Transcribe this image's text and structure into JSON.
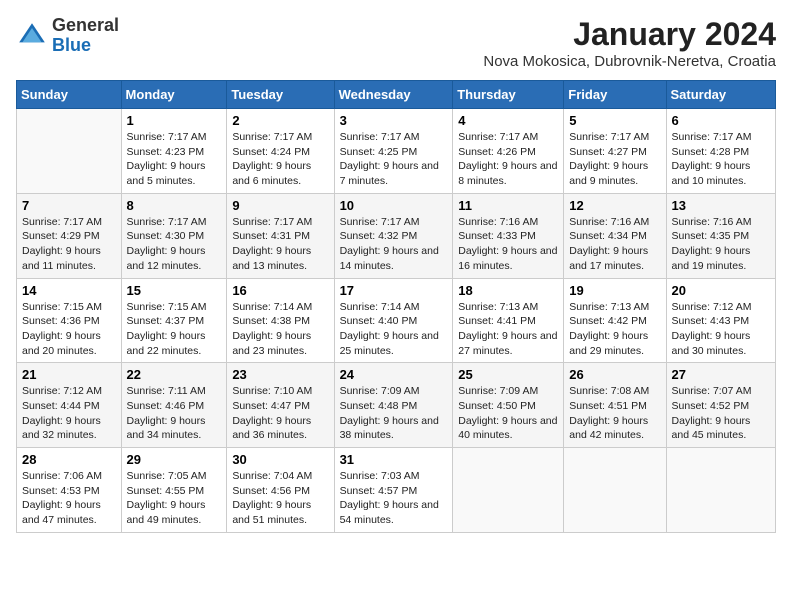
{
  "logo": {
    "general": "General",
    "blue": "Blue"
  },
  "title": "January 2024",
  "subtitle": "Nova Mokosica, Dubrovnik-Neretva, Croatia",
  "days": [
    "Sunday",
    "Monday",
    "Tuesday",
    "Wednesday",
    "Thursday",
    "Friday",
    "Saturday"
  ],
  "weeks": [
    [
      {
        "num": "",
        "sunrise": "",
        "sunset": "",
        "daylight": ""
      },
      {
        "num": "1",
        "sunrise": "Sunrise: 7:17 AM",
        "sunset": "Sunset: 4:23 PM",
        "daylight": "Daylight: 9 hours and 5 minutes."
      },
      {
        "num": "2",
        "sunrise": "Sunrise: 7:17 AM",
        "sunset": "Sunset: 4:24 PM",
        "daylight": "Daylight: 9 hours and 6 minutes."
      },
      {
        "num": "3",
        "sunrise": "Sunrise: 7:17 AM",
        "sunset": "Sunset: 4:25 PM",
        "daylight": "Daylight: 9 hours and 7 minutes."
      },
      {
        "num": "4",
        "sunrise": "Sunrise: 7:17 AM",
        "sunset": "Sunset: 4:26 PM",
        "daylight": "Daylight: 9 hours and 8 minutes."
      },
      {
        "num": "5",
        "sunrise": "Sunrise: 7:17 AM",
        "sunset": "Sunset: 4:27 PM",
        "daylight": "Daylight: 9 hours and 9 minutes."
      },
      {
        "num": "6",
        "sunrise": "Sunrise: 7:17 AM",
        "sunset": "Sunset: 4:28 PM",
        "daylight": "Daylight: 9 hours and 10 minutes."
      }
    ],
    [
      {
        "num": "7",
        "sunrise": "Sunrise: 7:17 AM",
        "sunset": "Sunset: 4:29 PM",
        "daylight": "Daylight: 9 hours and 11 minutes."
      },
      {
        "num": "8",
        "sunrise": "Sunrise: 7:17 AM",
        "sunset": "Sunset: 4:30 PM",
        "daylight": "Daylight: 9 hours and 12 minutes."
      },
      {
        "num": "9",
        "sunrise": "Sunrise: 7:17 AM",
        "sunset": "Sunset: 4:31 PM",
        "daylight": "Daylight: 9 hours and 13 minutes."
      },
      {
        "num": "10",
        "sunrise": "Sunrise: 7:17 AM",
        "sunset": "Sunset: 4:32 PM",
        "daylight": "Daylight: 9 hours and 14 minutes."
      },
      {
        "num": "11",
        "sunrise": "Sunrise: 7:16 AM",
        "sunset": "Sunset: 4:33 PM",
        "daylight": "Daylight: 9 hours and 16 minutes."
      },
      {
        "num": "12",
        "sunrise": "Sunrise: 7:16 AM",
        "sunset": "Sunset: 4:34 PM",
        "daylight": "Daylight: 9 hours and 17 minutes."
      },
      {
        "num": "13",
        "sunrise": "Sunrise: 7:16 AM",
        "sunset": "Sunset: 4:35 PM",
        "daylight": "Daylight: 9 hours and 19 minutes."
      }
    ],
    [
      {
        "num": "14",
        "sunrise": "Sunrise: 7:15 AM",
        "sunset": "Sunset: 4:36 PM",
        "daylight": "Daylight: 9 hours and 20 minutes."
      },
      {
        "num": "15",
        "sunrise": "Sunrise: 7:15 AM",
        "sunset": "Sunset: 4:37 PM",
        "daylight": "Daylight: 9 hours and 22 minutes."
      },
      {
        "num": "16",
        "sunrise": "Sunrise: 7:14 AM",
        "sunset": "Sunset: 4:38 PM",
        "daylight": "Daylight: 9 hours and 23 minutes."
      },
      {
        "num": "17",
        "sunrise": "Sunrise: 7:14 AM",
        "sunset": "Sunset: 4:40 PM",
        "daylight": "Daylight: 9 hours and 25 minutes."
      },
      {
        "num": "18",
        "sunrise": "Sunrise: 7:13 AM",
        "sunset": "Sunset: 4:41 PM",
        "daylight": "Daylight: 9 hours and 27 minutes."
      },
      {
        "num": "19",
        "sunrise": "Sunrise: 7:13 AM",
        "sunset": "Sunset: 4:42 PM",
        "daylight": "Daylight: 9 hours and 29 minutes."
      },
      {
        "num": "20",
        "sunrise": "Sunrise: 7:12 AM",
        "sunset": "Sunset: 4:43 PM",
        "daylight": "Daylight: 9 hours and 30 minutes."
      }
    ],
    [
      {
        "num": "21",
        "sunrise": "Sunrise: 7:12 AM",
        "sunset": "Sunset: 4:44 PM",
        "daylight": "Daylight: 9 hours and 32 minutes."
      },
      {
        "num": "22",
        "sunrise": "Sunrise: 7:11 AM",
        "sunset": "Sunset: 4:46 PM",
        "daylight": "Daylight: 9 hours and 34 minutes."
      },
      {
        "num": "23",
        "sunrise": "Sunrise: 7:10 AM",
        "sunset": "Sunset: 4:47 PM",
        "daylight": "Daylight: 9 hours and 36 minutes."
      },
      {
        "num": "24",
        "sunrise": "Sunrise: 7:09 AM",
        "sunset": "Sunset: 4:48 PM",
        "daylight": "Daylight: 9 hours and 38 minutes."
      },
      {
        "num": "25",
        "sunrise": "Sunrise: 7:09 AM",
        "sunset": "Sunset: 4:50 PM",
        "daylight": "Daylight: 9 hours and 40 minutes."
      },
      {
        "num": "26",
        "sunrise": "Sunrise: 7:08 AM",
        "sunset": "Sunset: 4:51 PM",
        "daylight": "Daylight: 9 hours and 42 minutes."
      },
      {
        "num": "27",
        "sunrise": "Sunrise: 7:07 AM",
        "sunset": "Sunset: 4:52 PM",
        "daylight": "Daylight: 9 hours and 45 minutes."
      }
    ],
    [
      {
        "num": "28",
        "sunrise": "Sunrise: 7:06 AM",
        "sunset": "Sunset: 4:53 PM",
        "daylight": "Daylight: 9 hours and 47 minutes."
      },
      {
        "num": "29",
        "sunrise": "Sunrise: 7:05 AM",
        "sunset": "Sunset: 4:55 PM",
        "daylight": "Daylight: 9 hours and 49 minutes."
      },
      {
        "num": "30",
        "sunrise": "Sunrise: 7:04 AM",
        "sunset": "Sunset: 4:56 PM",
        "daylight": "Daylight: 9 hours and 51 minutes."
      },
      {
        "num": "31",
        "sunrise": "Sunrise: 7:03 AM",
        "sunset": "Sunset: 4:57 PM",
        "daylight": "Daylight: 9 hours and 54 minutes."
      },
      {
        "num": "",
        "sunrise": "",
        "sunset": "",
        "daylight": ""
      },
      {
        "num": "",
        "sunrise": "",
        "sunset": "",
        "daylight": ""
      },
      {
        "num": "",
        "sunrise": "",
        "sunset": "",
        "daylight": ""
      }
    ]
  ]
}
